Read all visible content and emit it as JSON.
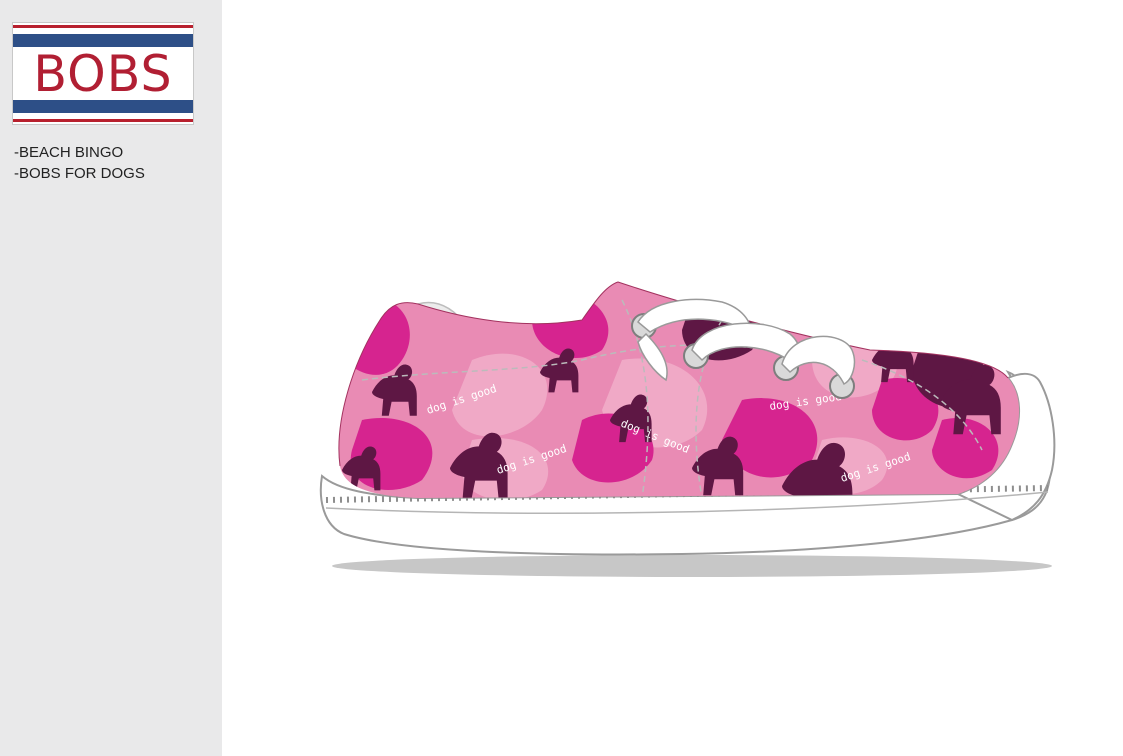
{
  "brand": {
    "logo_text": "BOBS",
    "red": "#b11f33",
    "navy": "#2d4f87"
  },
  "notes": {
    "line1": "-BEACH BINGO",
    "line2": "-BOBS FOR DOGS"
  },
  "shoe": {
    "print_text": "dog is good",
    "colors": {
      "base_pink": "#e98bb4",
      "light_pink": "#f0a9c6",
      "magenta": "#d6248f",
      "plum": "#5e1744",
      "sole": "#ffffff",
      "shadow": "#c7c7c7"
    },
    "icons": [
      "dog-silhouette-icon",
      "lace-icon",
      "eyelet-icon"
    ]
  }
}
